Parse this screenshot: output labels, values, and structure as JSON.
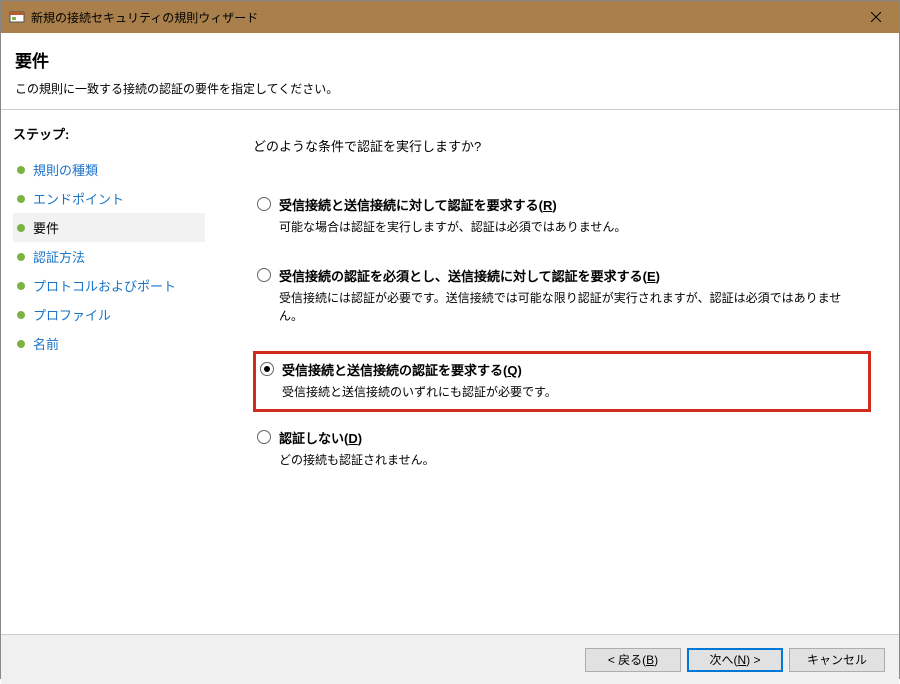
{
  "window": {
    "title": "新規の接続セキュリティの規則ウィザード"
  },
  "header": {
    "title": "要件",
    "subtitle": "この規則に一致する接続の認証の要件を指定してください。"
  },
  "sidebar": {
    "title": "ステップ:",
    "items": [
      {
        "label": "規則の種類",
        "active": false
      },
      {
        "label": "エンドポイント",
        "active": false
      },
      {
        "label": "要件",
        "active": true
      },
      {
        "label": "認証方法",
        "active": false
      },
      {
        "label": "プロトコルおよびポート",
        "active": false
      },
      {
        "label": "プロファイル",
        "active": false
      },
      {
        "label": "名前",
        "active": false
      }
    ]
  },
  "main": {
    "question": "どのような条件で認証を実行しますか?",
    "options": [
      {
        "label_pre": "受信接続と送信接続に対して認証を要求する(",
        "accel": "R",
        "label_post": ")",
        "desc": "可能な場合は認証を実行しますが、認証は必須ではありません。",
        "checked": false,
        "highlighted": false
      },
      {
        "label_pre": "受信接続の認証を必須とし、送信接続に対して認証を要求する(",
        "accel": "E",
        "label_post": ")",
        "desc": "受信接続には認証が必要です。送信接続では可能な限り認証が実行されますが、認証は必須ではありません。",
        "checked": false,
        "highlighted": false
      },
      {
        "label_pre": "受信接続と送信接続の認証を要求する(",
        "accel": "Q",
        "label_post": ")",
        "desc": "受信接続と送信接続のいずれにも認証が必要です。",
        "checked": true,
        "highlighted": true
      },
      {
        "label_pre": "認証しない(",
        "accel": "D",
        "label_post": ")",
        "desc": "どの接続も認証されません。",
        "checked": false,
        "highlighted": false
      }
    ]
  },
  "footer": {
    "back_pre": "< 戻る(",
    "back_accel": "B",
    "back_post": ")",
    "next_pre": "次へ(",
    "next_accel": "N",
    "next_post": ") >",
    "cancel": "キャンセル"
  }
}
